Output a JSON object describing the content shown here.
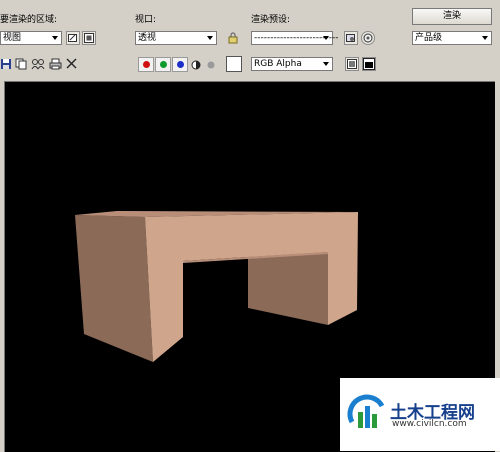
{
  "toolbar": {
    "area_label": "要渲染的区域:",
    "area_value": "视图",
    "viewport_label": "视口:",
    "viewport_value": "透视",
    "preset_label": "渲染预设:",
    "preset_value": "--------------------------",
    "render_button": "渲染",
    "quality_value": "产品级",
    "channel_value": "RGB Alpha"
  },
  "colors": {
    "red_channel": "#d01010",
    "green_channel": "#0f9a2c",
    "blue_channel": "#1c2fc8",
    "background_swatch": "#ffffff",
    "box_front": "#cfa68b",
    "box_side": "#8b6a58",
    "box_top": "#b88e79"
  },
  "watermark": {
    "brand": "土木工程网",
    "url": "www.civilcn.com"
  }
}
